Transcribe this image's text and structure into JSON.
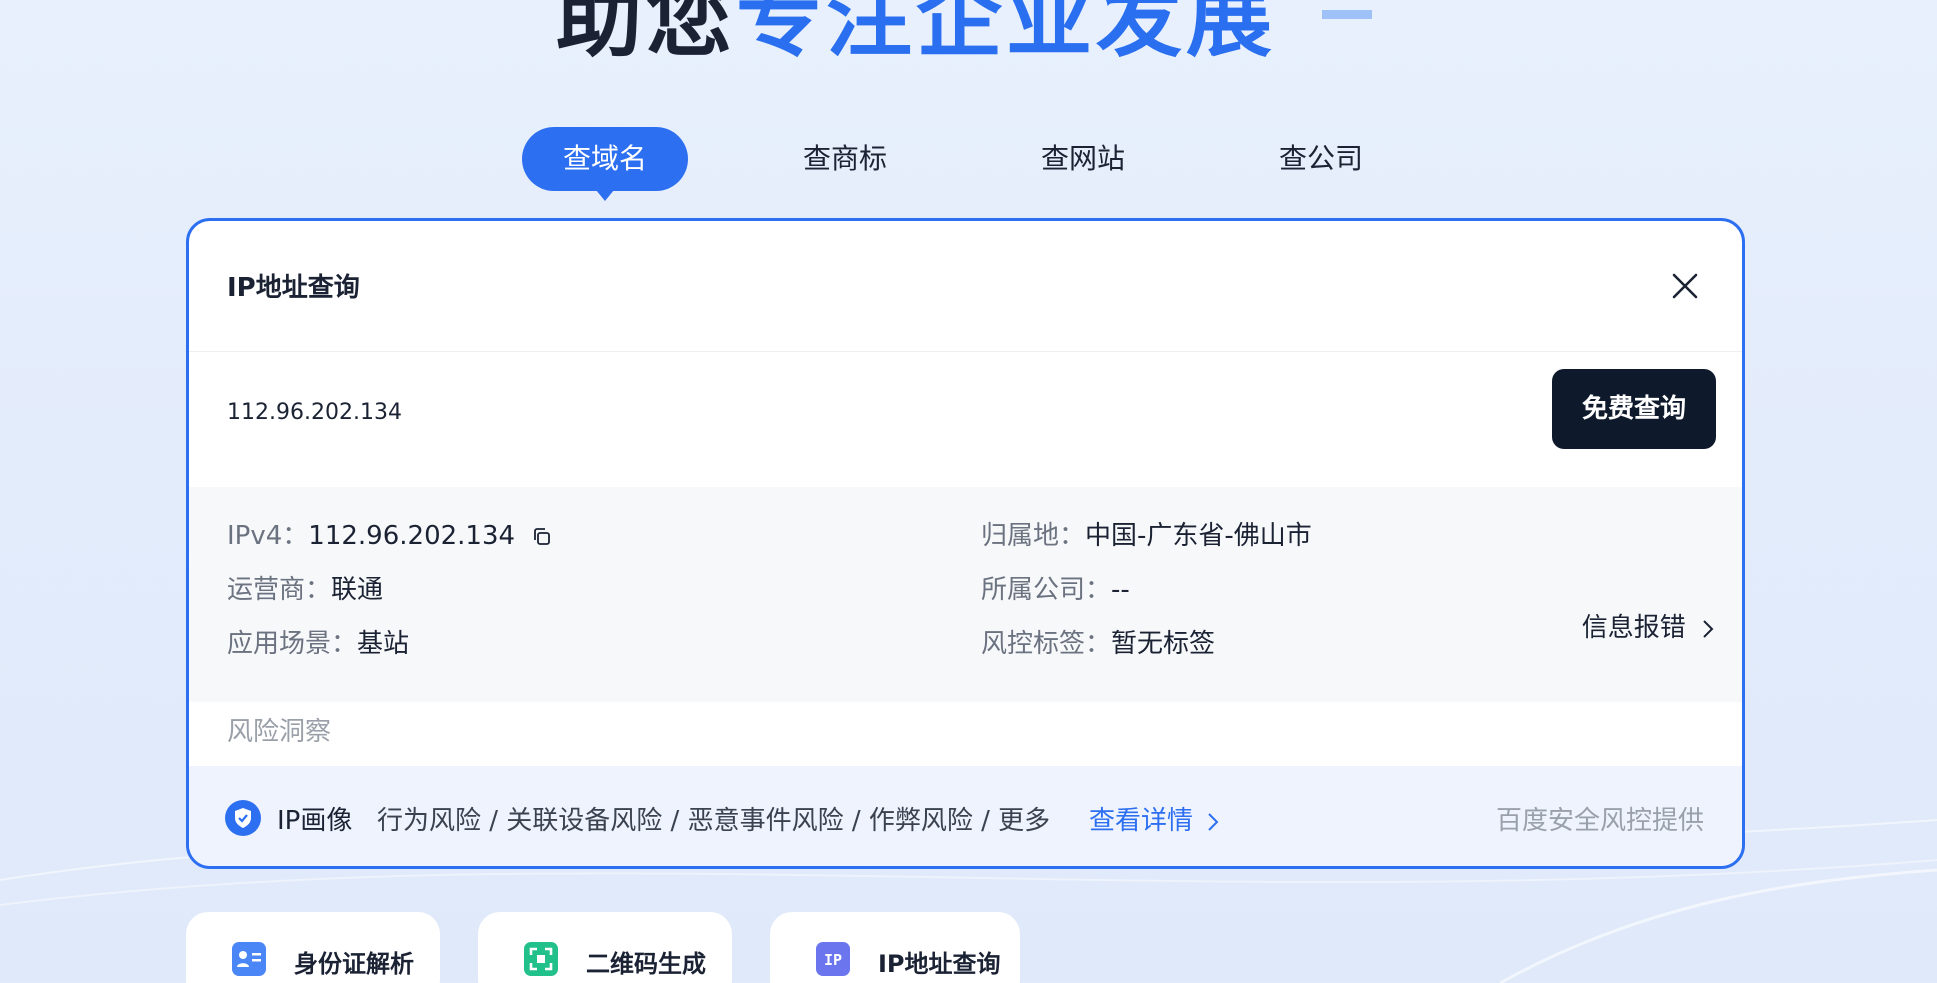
{
  "hero": {
    "title_prefix": "助您",
    "title_accent": "专注企业发展"
  },
  "tabs": [
    {
      "label": "查域名",
      "active": true
    },
    {
      "label": "查商标",
      "active": false
    },
    {
      "label": "查网站",
      "active": false
    },
    {
      "label": "查公司",
      "active": false
    }
  ],
  "card": {
    "title": "IP地址查询",
    "query_value": "112.96.202.134",
    "query_button": "免费查询",
    "result": {
      "ipv4_label": "IPv4：",
      "ipv4_value": "112.96.202.134",
      "location_label": "归属地：",
      "location_value": "中国-广东省-佛山市",
      "isp_label": "运营商：",
      "isp_value": "联通",
      "company_label": "所属公司：",
      "company_value": "--",
      "scene_label": "应用场景：",
      "scene_value": "基站",
      "risk_tag_label": "风控标签：",
      "risk_tag_value": "暂无标签"
    },
    "report_link": "信息报错",
    "section_label": "风险洞察",
    "insight": {
      "title": "IP画像",
      "risks": "行为风险 / 关联设备风险 / 恶意事件风险 / 作弊风险 / 更多",
      "details_link": "查看详情",
      "provider": "百度安全风控提供"
    }
  },
  "tools": [
    {
      "label": "身份证解析",
      "icon": "id-card-icon",
      "color": "#4a86f5"
    },
    {
      "label": "二维码生成",
      "icon": "qr-code-icon",
      "color": "#22c08a"
    },
    {
      "label": "IP地址查询",
      "icon": "ip-icon",
      "color": "#6a75ee"
    }
  ],
  "colors": {
    "accent": "#2d6ff1",
    "dark_button": "#0e1a2b"
  }
}
